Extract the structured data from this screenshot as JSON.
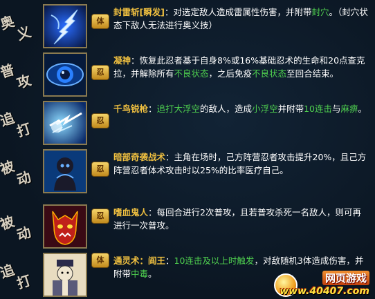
{
  "skills": [
    {
      "category": [
        "奥",
        "义"
      ],
      "badge": "体",
      "parts": [
        {
          "t": "封雷斩",
          "c": "y b"
        },
        {
          "t": "[瞬发]",
          "c": "y b"
        },
        {
          "t": "：对选定敌人造成雷属性伤害，并附带",
          "c": "w"
        },
        {
          "t": "封穴",
          "c": "g"
        },
        {
          "t": "。（封穴状态下敌人无法进行奥义技）",
          "c": "w"
        }
      ]
    },
    {
      "category": [
        "普",
        "攻"
      ],
      "badge": "忍",
      "parts": [
        {
          "t": "凝神",
          "c": "y b"
        },
        {
          "t": "：恢复此忍者基于自身8%或16%基础忍术的生命和20点查克拉，并解除所有",
          "c": "w"
        },
        {
          "t": "不良状态",
          "c": "g"
        },
        {
          "t": "，之后免疫",
          "c": "w"
        },
        {
          "t": "不良状态",
          "c": "g"
        },
        {
          "t": "至回合结束。",
          "c": "w"
        }
      ]
    },
    {
      "category": [
        "追",
        "打"
      ],
      "badge": "忍",
      "parts": [
        {
          "t": "千鸟锐枪",
          "c": "y b"
        },
        {
          "t": "：",
          "c": "w"
        },
        {
          "t": "追打大浮空",
          "c": "g"
        },
        {
          "t": "的敌人，造成",
          "c": "w"
        },
        {
          "t": "小浮空",
          "c": "g"
        },
        {
          "t": "并附带",
          "c": "w"
        },
        {
          "t": "10连击",
          "c": "g"
        },
        {
          "t": "与",
          "c": "w"
        },
        {
          "t": "麻痹",
          "c": "g"
        },
        {
          "t": "。",
          "c": "w"
        }
      ]
    },
    {
      "category": [
        "被",
        "动"
      ],
      "badge": "忍",
      "parts": [
        {
          "t": "暗部奇袭战术",
          "c": "y b"
        },
        {
          "t": "：主角在场时，己方阵营忍者攻击提升20%，且己方阵营忍者体术攻击时以25%的比率医疗自己。",
          "c": "w"
        }
      ]
    },
    {
      "category": [
        "被",
        "动"
      ],
      "badge": "忍",
      "parts": [
        {
          "t": "嗜血鬼人",
          "c": "y b"
        },
        {
          "t": "：每回合进行2次普攻，且若普攻杀死一名敌人，则可再进行一次普攻。",
          "c": "w"
        }
      ]
    },
    {
      "category": [
        "追",
        "打"
      ],
      "badge": "体",
      "parts": [
        {
          "t": "通灵术：阎王",
          "c": "y b"
        },
        {
          "t": "：",
          "c": "w"
        },
        {
          "t": "10连击及以上时触发",
          "c": "g"
        },
        {
          "t": "，对敌随机3体造成伤害，并附带",
          "c": "w"
        },
        {
          "t": "中毒",
          "c": "g"
        },
        {
          "t": "。",
          "c": "w"
        }
      ]
    }
  ],
  "watermark": {
    "top": "网页游戏",
    "bottom": "www.40407.com"
  },
  "colors": {
    "highlight_yellow": "#f0c040",
    "status_green": "#4fd04f",
    "text_white": "#ffffff"
  }
}
